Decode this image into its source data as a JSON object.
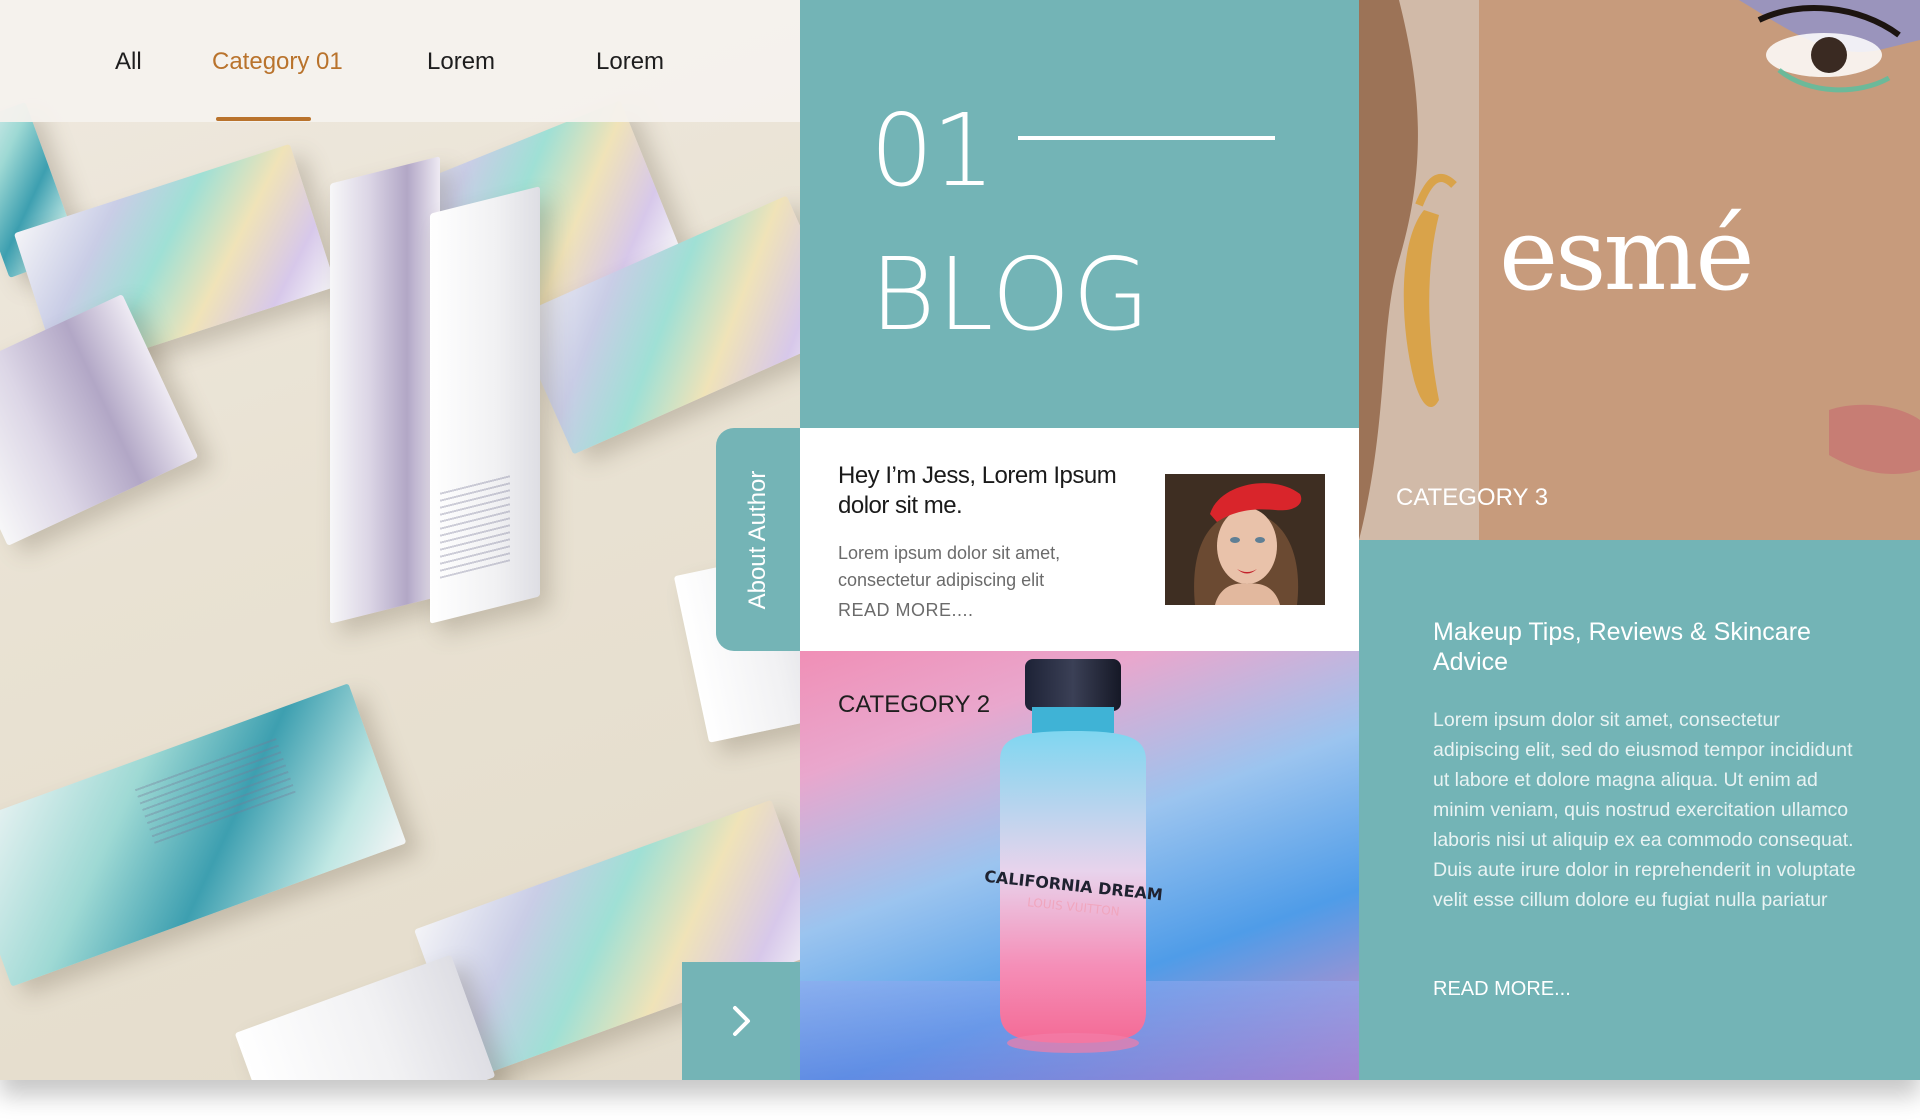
{
  "nav": {
    "items": [
      {
        "label": "All",
        "active": false
      },
      {
        "label": "Category 01",
        "active": true
      },
      {
        "label": "Lorem",
        "active": false
      },
      {
        "label": "Lorem",
        "active": false
      }
    ],
    "active_color": "#b9732c"
  },
  "blog": {
    "number": "01",
    "title": "BLOG"
  },
  "about_tab": {
    "label": "About Author"
  },
  "author_card": {
    "title": "Hey I’m Jess, Lorem Ipsum dolor sit me.",
    "description": "Lorem ipsum dolor sit amet, consectetur adipiscing elit",
    "read_more": "READ MORE...."
  },
  "category2": {
    "label": "CATEGORY 2",
    "bottle_text": "CALIFORNIA DREAM",
    "bottle_subtext": "LOUIS VUITTON"
  },
  "category3": {
    "label": "CATEGORY 3",
    "logo": "esmé"
  },
  "info": {
    "heading": "Makeup Tips, Reviews & Skincare Advice",
    "body": "Lorem ipsum dolor sit amet, consectetur adipiscing elit, sed do eiusmod tempor incididunt ut labore et dolore magna aliqua. Ut enim ad minim veniam, quis nostrud exercitation ullamco laboris nisi ut aliquip ex ea commodo consequat. Duis aute irure dolor in reprehenderit in voluptate velit esse cillum dolore eu fugiat nulla pariatur",
    "read_more": "READ MORE..."
  },
  "next_button": {
    "icon": "chevron-right-icon"
  },
  "colors": {
    "teal": "#73b4b6",
    "accent": "#b9732c",
    "text_dark": "#1e1e1e"
  }
}
